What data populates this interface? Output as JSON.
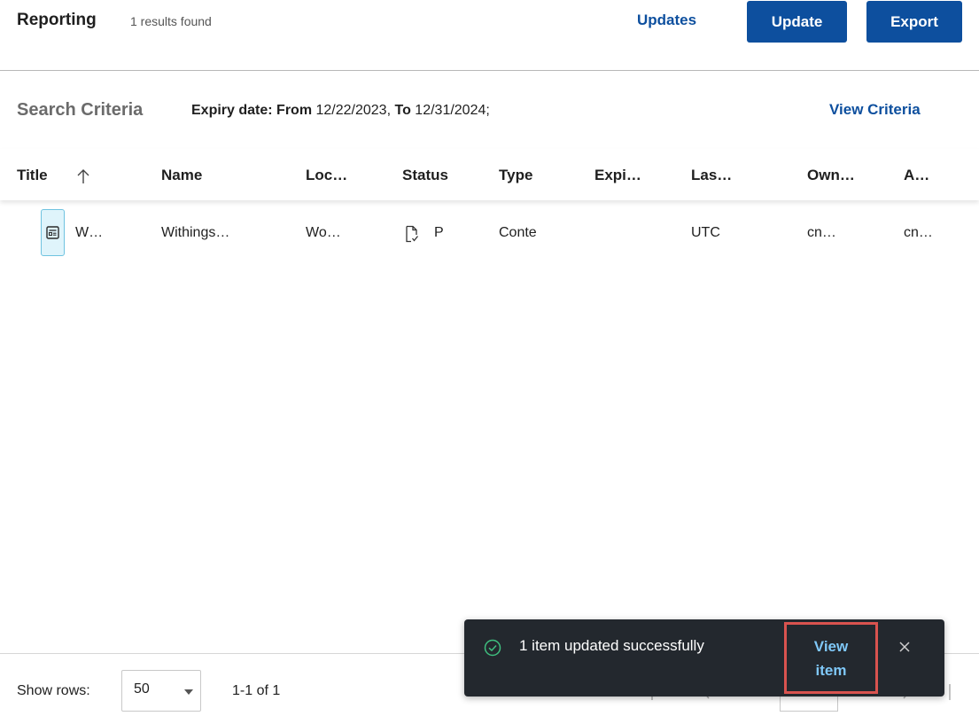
{
  "header": {
    "title": "Reporting",
    "results": "1 results found",
    "updates_link": "Updates",
    "update_button": "Update",
    "export_button": "Export"
  },
  "criteria": {
    "label": "Search Criteria",
    "field": "Expiry date:",
    "from_label": "From",
    "from_value": "12/22/2023,",
    "to_label": "To",
    "to_value": "12/31/2024;",
    "view_link": "View Criteria"
  },
  "table": {
    "columns": [
      "Title",
      "Name",
      "Loc…",
      "Status",
      "Type",
      "Expi…",
      "Las…",
      "Own…",
      "A…"
    ],
    "rows": [
      {
        "title": "W…",
        "name": "Withings…",
        "location": "Wo…",
        "status": "P",
        "type": "Conte",
        "expiry": "",
        "last": "UTC",
        "owner": "cn…",
        "a": "cn…"
      }
    ]
  },
  "footer": {
    "show_rows_label": "Show rows:",
    "rows_value": "50",
    "range": "1-1 of 1"
  },
  "toast": {
    "message": "1 item updated successfully",
    "action_line1": "View",
    "action_line2": "item"
  },
  "colors": {
    "primary": "#0d4f9e",
    "toast_bg": "#23282e",
    "toast_action": "#7fc8f8",
    "highlight": "#d9534f",
    "success": "#3fbf7f"
  },
  "icons": {
    "sort": "arrow-up-icon",
    "row": "content-card-icon",
    "status": "document-check-icon",
    "toast": "check-circle-icon",
    "close": "close-icon"
  }
}
